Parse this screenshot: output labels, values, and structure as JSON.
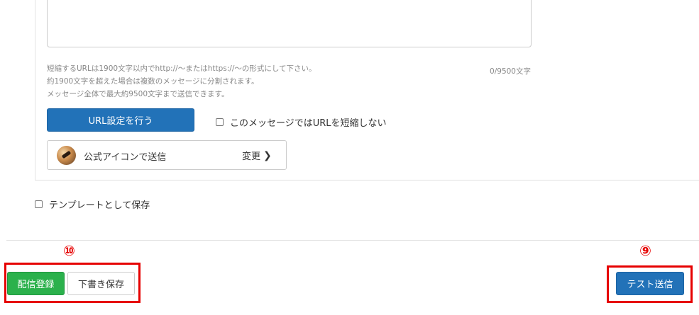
{
  "message": {
    "help_lines": [
      "短縮するURLは1900文字以内でhttp://〜またはhttps://〜の形式にして下さい。",
      "約1900文字を超えた場合は複数のメッセージに分割されます。",
      "メッセージ全体で最大約9500文字まで送信できます。"
    ],
    "char_counter": "0/9500文字",
    "url_button": "URL設定を行う",
    "no_shorten_label": "このメッセージではURLを短縮しない",
    "sender_label": "公式アイコンで送信",
    "change_label": "変更",
    "change_icon": "chevron-right-icon"
  },
  "template": {
    "save_as_template_label": "テンプレートとして保存"
  },
  "footer": {
    "marker_left": "⑩",
    "marker_right": "⑨",
    "register_button": "配信登録",
    "draft_button": "下書き保存",
    "test_send_button": "テスト送信"
  },
  "colors": {
    "primary_blue": "#2272b8",
    "success_green": "#2bb14c",
    "highlight_red": "#e60000"
  }
}
